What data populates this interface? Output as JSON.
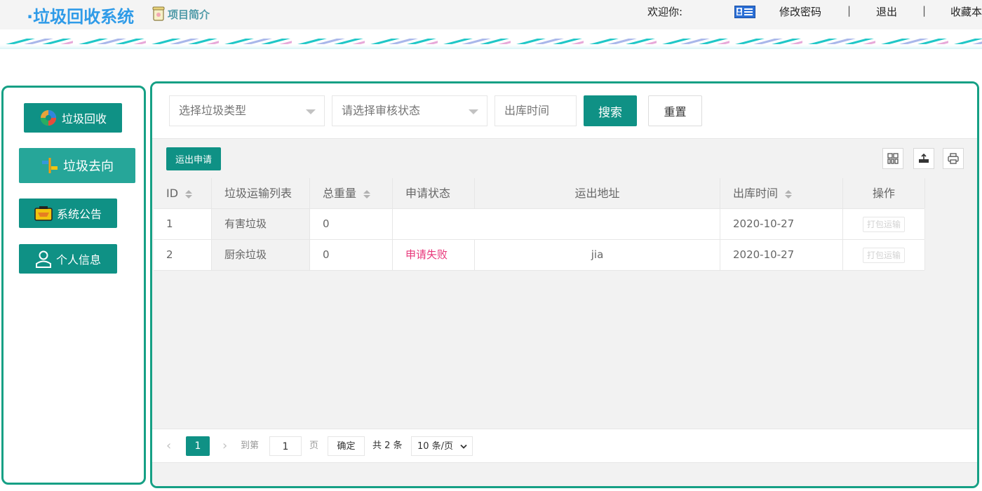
{
  "header": {
    "app_title": "·垃圾回收系统",
    "intro_label": "项目简介",
    "welcome": "欢迎你:",
    "change_password": "修改密码",
    "sep1": "|",
    "logout": "退出",
    "sep2": "|",
    "favorite": "收藏本"
  },
  "sidebar": {
    "items": [
      {
        "label": "垃圾回收",
        "icon": "recycle-icon"
      },
      {
        "label": "垃圾去向",
        "icon": "direction-icon"
      },
      {
        "label": "系统公告",
        "icon": "announcement-icon"
      },
      {
        "label": "个人信息",
        "icon": "user-icon"
      }
    ]
  },
  "filters": {
    "garbage_type_placeholder": "选择垃圾类型",
    "audit_status_placeholder": "请选择审核状态",
    "out_time_placeholder": "出库时间",
    "search_label": "搜索",
    "reset_label": "重置"
  },
  "toolbar": {
    "apply_label": "运出申请",
    "icons": [
      "columns-icon",
      "export-icon",
      "print-icon"
    ]
  },
  "table": {
    "columns": [
      "ID",
      "垃圾运输列表",
      "总重量",
      "申请状态",
      "运出地址",
      "出库时间",
      "操作"
    ],
    "rows": [
      {
        "id": "1",
        "list": "有害垃圾",
        "weight": "0",
        "status": "",
        "address": "",
        "time": "2020-10-27",
        "action": "打包运输"
      },
      {
        "id": "2",
        "list": "厨余垃圾",
        "weight": "0",
        "status": "申请失败",
        "address": "jia",
        "time": "2020-10-27",
        "action": "打包运输"
      }
    ]
  },
  "pagination": {
    "current_page": "1",
    "goto_label": "到第",
    "goto_value": "1",
    "page_unit": "页",
    "confirm_label": "确定",
    "total": "共 2 条",
    "page_size": "10 条/页"
  },
  "colors": {
    "primary": "#0f9185",
    "border": "#16a085",
    "logo": "#2f9be8",
    "fail_status": "#e8377a"
  }
}
